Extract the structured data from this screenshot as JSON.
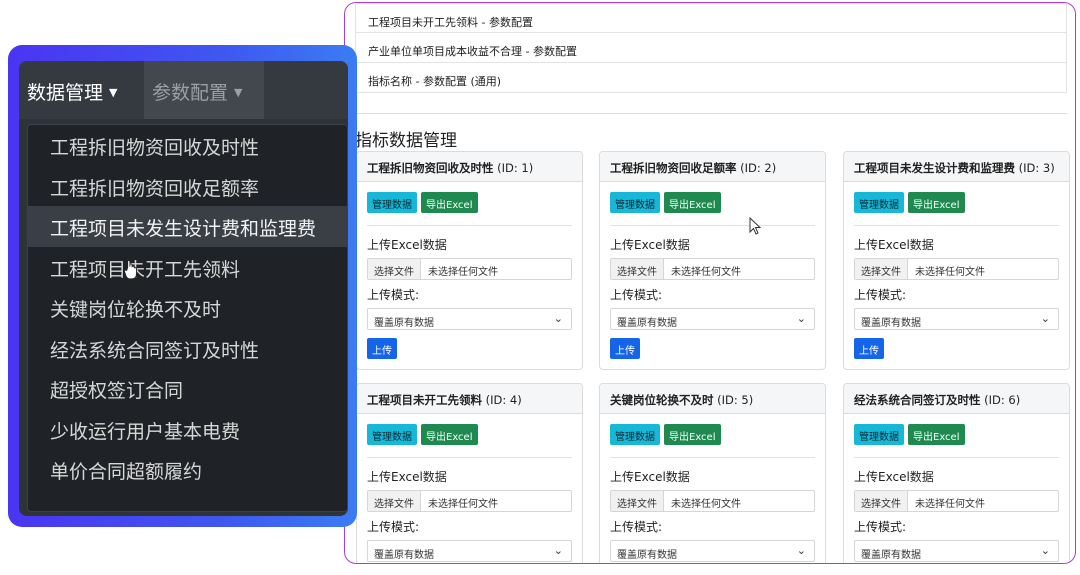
{
  "config_list": [
    "工程项目未开工先领料 - 参数配置",
    "产业单位单项目成本收益不合理 - 参数配置",
    "指标名称 - 参数配置 (通用)"
  ],
  "section_title": "指标数据管理",
  "card_common": {
    "manage_btn": "管理数据",
    "export_btn": "导出Excel",
    "upload_label": "上传Excel数据",
    "file_btn": "选择文件",
    "file_none": "未选择任何文件",
    "mode_label": "上传模式:",
    "mode_value": "覆盖原有数据",
    "upload_btn": "上传"
  },
  "cards": [
    {
      "name": "工程拆旧物资回收及时性",
      "id": "(ID: 1)"
    },
    {
      "name": "工程拆旧物资回收足额率",
      "id": "(ID: 2)"
    },
    {
      "name": "工程项目未发生设计费和监理费",
      "id": "(ID: 3)"
    },
    {
      "name": "工程项目未开工先领料",
      "id": "(ID: 4)"
    },
    {
      "name": "关键岗位轮换不及时",
      "id": "(ID: 5)"
    },
    {
      "name": "经法系统合同签订及时性",
      "id": "(ID: 6)"
    }
  ],
  "navbar": {
    "data_mgmt": "数据管理",
    "param_config": "参数配置"
  },
  "dropdown_items": [
    "工程拆旧物资回收及时性",
    "工程拆旧物资回收足额率",
    "工程项目未发生设计费和监理费",
    "工程项目未开工先领料",
    "关键岗位轮换不及时",
    "经法系统合同签订及时性",
    "超授权签订合同",
    "少收运行用户基本电费",
    "单价合同超额履约"
  ],
  "colors": {
    "frame_border": "#a640d8",
    "btn_info": "#17b7d8",
    "btn_success": "#1f8a4f",
    "btn_primary": "#1565e8",
    "overlay_gradient_start": "#4a35f2",
    "overlay_gradient_end": "#3b7cf2"
  },
  "icons": {
    "nav_caret": "caret-down-icon",
    "select_chevron": "chevron-down-icon",
    "cursor": "mouse-pointer-icon"
  }
}
